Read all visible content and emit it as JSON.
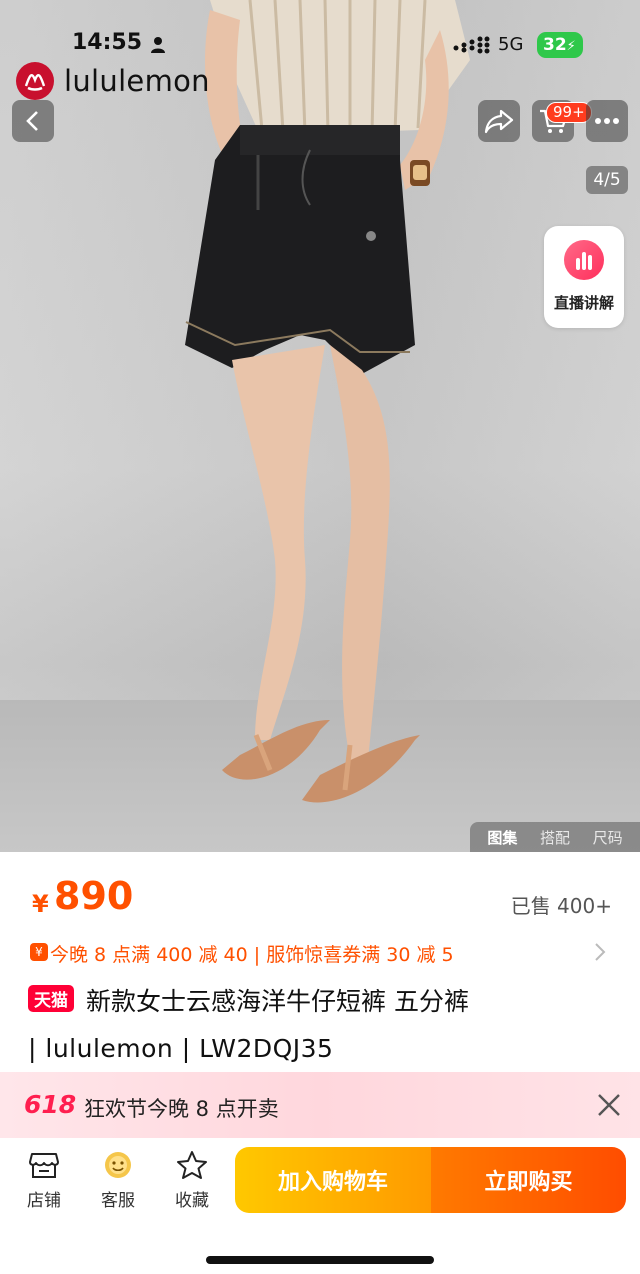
{
  "status_bar": {
    "time": "14:55",
    "network": "5G",
    "battery": "32"
  },
  "brand": {
    "name": "lululemon"
  },
  "header": {
    "cart_badge": "99+",
    "image_counter": "4/5",
    "live_label": "直播讲解"
  },
  "gallery_tabs": [
    "图集",
    "搭配",
    "尺码"
  ],
  "product": {
    "currency": "¥",
    "price": "890",
    "sold": "已售 400+",
    "promo": "今晚 8 点满 400 减 40 | 服饰惊喜券满 30 减 5",
    "platform_badge": "天猫",
    "title_line1": "新款女士云感海洋牛仔短裤  五分裤",
    "title_line2": "| lululemon | LW2DQJ35"
  },
  "banner": {
    "logo": "618",
    "text": "狂欢节今晚 8 点开卖"
  },
  "bottom_bar": {
    "shop_label": "店铺",
    "service_label": "客服",
    "favorite_label": "收藏",
    "add_to_cart": "加入购物车",
    "buy_now": "立即购买"
  },
  "colors": {
    "accent": "#ff5000",
    "tmall": "#ff0036",
    "brand_red": "#c8102e",
    "cta_yellow": "#ffb400",
    "cta_orange": "#ff5a00"
  }
}
